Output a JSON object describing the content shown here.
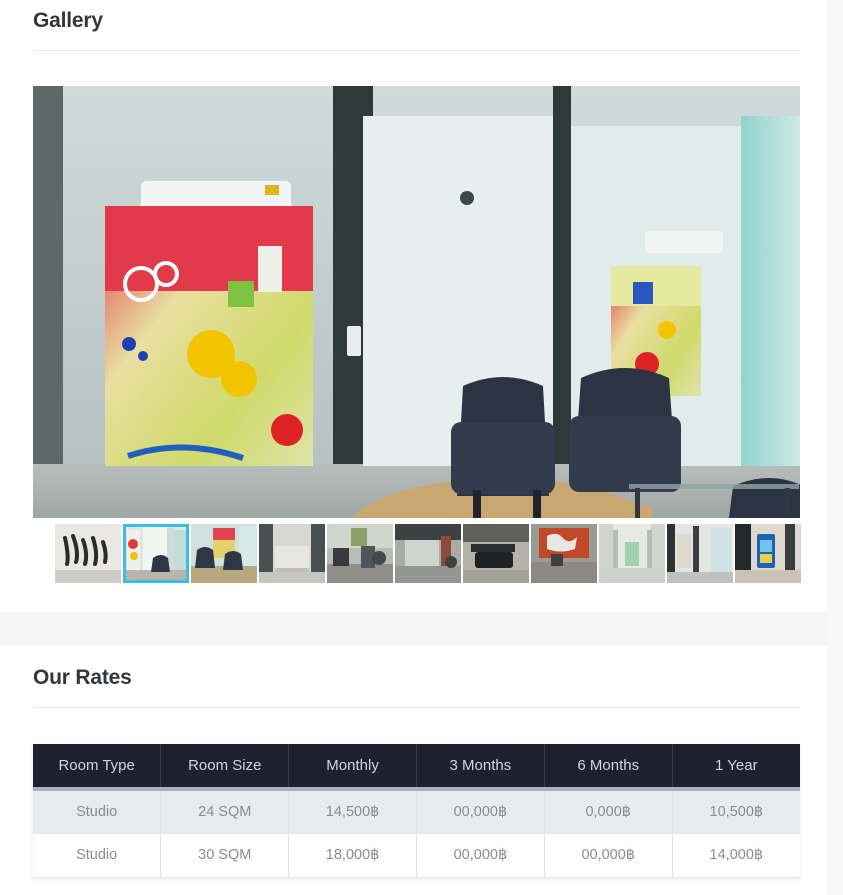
{
  "gallery": {
    "title": "Gallery",
    "main_image_alt": "Lounge with abstract paintings, dark armchairs and glass coffee table",
    "thumbnails": [
      {
        "alt": "Lobby wall signage lettering",
        "active": false
      },
      {
        "alt": "Corridor with colourful artwork and armchairs",
        "active": true
      },
      {
        "alt": "Seating area with painting and armchairs",
        "active": false
      },
      {
        "alt": "Reception counter area",
        "active": false
      },
      {
        "alt": "Gym with cardio machines by windows",
        "active": false
      },
      {
        "alt": "Gym interior with brick wall",
        "active": false
      },
      {
        "alt": "Treadmill and weight machines",
        "active": false
      },
      {
        "alt": "Gym with orange world map mural",
        "active": false
      },
      {
        "alt": "Residential hallway with doors",
        "active": false
      },
      {
        "alt": "Glass doors and stairwell landing",
        "active": false
      },
      {
        "alt": "Corridor with blue vending machine",
        "active": false
      }
    ]
  },
  "rates": {
    "title": "Our Rates",
    "columns": [
      "Room Type",
      "Room Size",
      "Monthly",
      "3 Months",
      "6 Months",
      "1 Year"
    ],
    "rows": [
      [
        "Studio",
        "24 SQM",
        "14,500฿",
        "00,000฿",
        "0,000฿",
        "10,500฿"
      ],
      [
        "Studio",
        "30 SQM",
        "18,000฿",
        "00,000฿",
        "00,000฿",
        "14,000฿"
      ]
    ]
  },
  "theme": {
    "heading_color": "#32373c",
    "table_header_bg": "#1d2130",
    "table_header_text": "#d4d7dd",
    "table_cell_text": "#868c99",
    "row_alt_bg": "#e9eaec",
    "active_thumb_border": "#3bbde4",
    "band_bg": "#f5f5f5",
    "page_bg": "#ffffff"
  }
}
